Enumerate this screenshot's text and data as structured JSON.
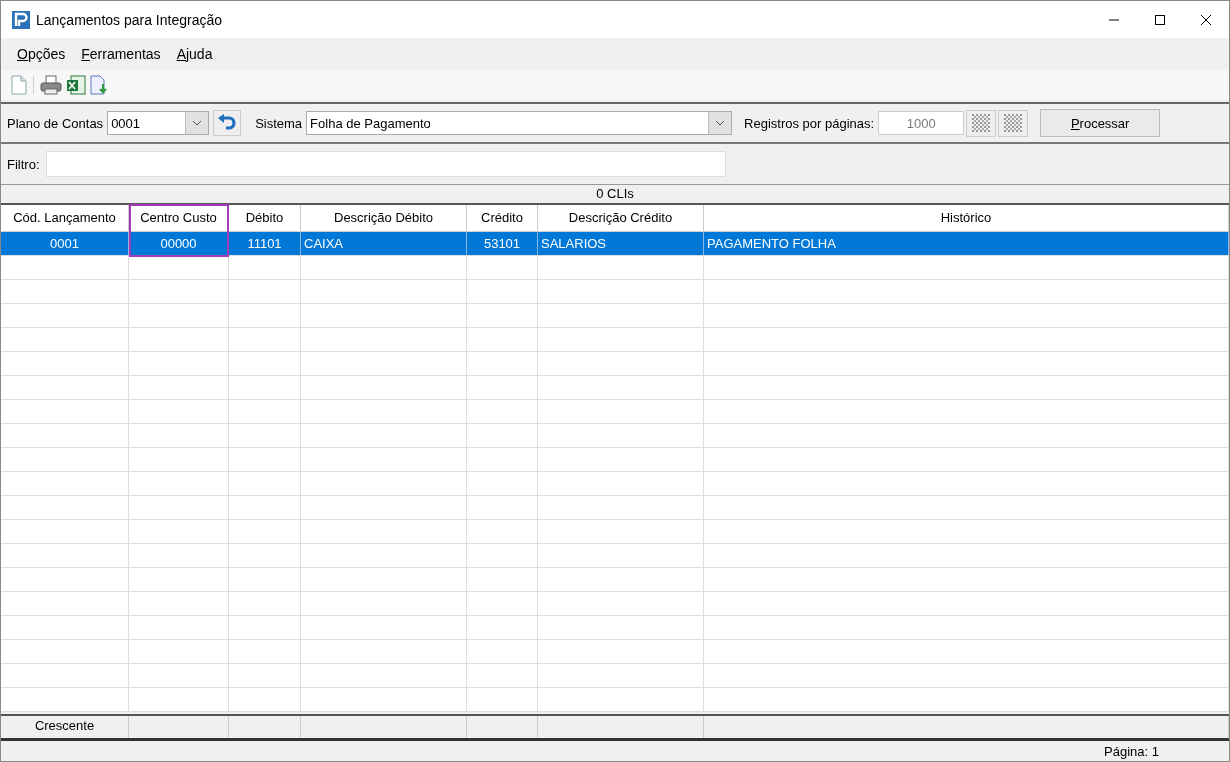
{
  "window": {
    "title": "Lançamentos para Integração"
  },
  "menu": [
    {
      "label": "Opções",
      "underline_first": true
    },
    {
      "label": "Ferramentas",
      "underline_first": true
    },
    {
      "label": "Ajuda",
      "underline_first": true
    }
  ],
  "filters": {
    "plano_label": "Plano de Contas",
    "plano_value": "0001",
    "sistema_label": "Sistema",
    "sistema_value": "Folha de Pagamento",
    "registros_label": "Registros por páginas:",
    "registros_value": "1000",
    "process_button": "Processar",
    "filtro_label": "Filtro:"
  },
  "count_bar": "0 CLIs",
  "table": {
    "columns": [
      {
        "label": "Cód. Lançamento",
        "highlighted": false
      },
      {
        "label": "Centro Custo",
        "highlighted": true
      },
      {
        "label": "Débito",
        "highlighted": false
      },
      {
        "label": "Descrição Débito",
        "highlighted": false
      },
      {
        "label": "Crédito",
        "highlighted": false
      },
      {
        "label": "Descrição Crédito",
        "highlighted": false
      },
      {
        "label": "Histórico",
        "highlighted": false
      }
    ],
    "rows": [
      {
        "selected": true,
        "cells": [
          "0001",
          "00000",
          "11101",
          "CAIXA",
          "53101",
          "SALARIOS",
          "PAGAMENTO FOLHA"
        ]
      }
    ],
    "footer": [
      "Crescente"
    ]
  },
  "status_bar": {
    "page": "Página: 1"
  }
}
